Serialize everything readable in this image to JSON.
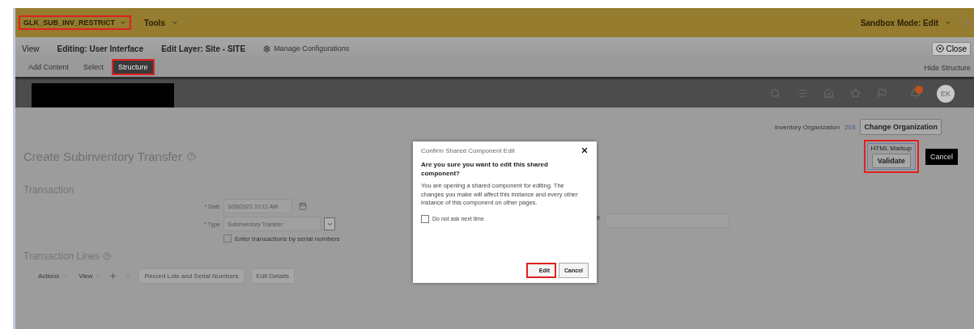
{
  "top_bar": {
    "sandbox": {
      "label": "GLK_SUB_INV_RESTRICT",
      "highlighted": true
    },
    "menus": [
      "Tools"
    ],
    "mode": "Sandbox Mode: Edit"
  },
  "editor_bar": {
    "view": "View",
    "editing": "Editing: User Interface",
    "layer": "Edit Layer: Site - SITE",
    "manage": "Manage Configurations",
    "close": "Close"
  },
  "modes": [
    {
      "label": "Add Content",
      "selected": false,
      "highlighted": false
    },
    {
      "label": "Select",
      "selected": false,
      "highlighted": false
    },
    {
      "label": "Structure",
      "selected": true,
      "highlighted": true
    }
  ],
  "hide_structure": "Hide Structure",
  "header": {
    "avatar": "EK"
  },
  "page": {
    "title": "Create Subinventory Transfer",
    "org_label": "Inventory Organization",
    "org_value": "203",
    "change_org": "Change Organization",
    "markup_label": "HTML Markup",
    "validate": "Validate",
    "markup_highlighted": true,
    "cancel": "Cancel"
  },
  "transaction": {
    "heading": "Transaction",
    "fields": [
      {
        "label": "Date",
        "mark": "*",
        "value": "3/26/2021 10:11 AM",
        "kind": "date"
      },
      {
        "label": "Type",
        "mark": "*",
        "value": "Subinventory Transfer",
        "kind": "select"
      }
    ],
    "serial": {
      "label": "Enter transactions by serial numbers",
      "checked": false
    },
    "side_field": {
      "label": "e"
    }
  },
  "lines": {
    "heading": "Transaction Lines",
    "menus": [
      "Actions",
      "View"
    ],
    "buttons": [
      {
        "label": "Record Lots and Serial Numbers",
        "disabled": true
      },
      {
        "label": "Edit Details",
        "disabled": true
      }
    ]
  },
  "dialog": {
    "title": "Confirm Shared Component Edit",
    "question": "Are you sure you want to edit this shared component?",
    "message": "You are opening a shared component for editing. The changes you make will affect this instance and every other instance of this component on other pages.",
    "dont_ask": {
      "label": "Do not ask next time",
      "checked": false
    },
    "buttons": [
      {
        "label": "Edit",
        "highlighted": true
      },
      {
        "label": "Cancel",
        "highlighted": false
      }
    ]
  }
}
